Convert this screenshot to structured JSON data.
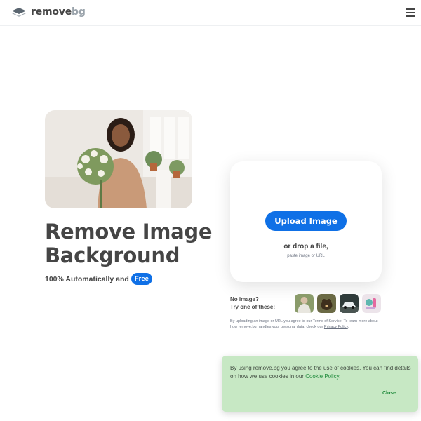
{
  "header": {
    "logo_primary": "remove",
    "logo_secondary": "bg",
    "menu_icon": "hamburger-icon"
  },
  "hero": {
    "title_line1": "Remove Image",
    "title_line2": "Background",
    "subtitle": "100% Automatically and",
    "free_badge": "Free",
    "accent_color": "#0f70e6"
  },
  "upload": {
    "button_label": "Upload Image",
    "drop_text": "or drop a file,",
    "paste_prefix": "paste image or",
    "paste_link": "URL"
  },
  "samples": {
    "line1": "No image?",
    "line2": "Try one of these:",
    "items": [
      "sample-person",
      "sample-animal",
      "sample-car",
      "sample-product"
    ]
  },
  "terms": {
    "part1": "By uploading an image or URL you agree to our",
    "tos_link": "Terms of Service",
    "part2": ". To learn more about how remove.bg handles your personal data, check our",
    "privacy_link": "Privacy Policy",
    "part3": "."
  },
  "cookie": {
    "text": "By using remove.bg you agree to the use of cookies. You can find details on how we use cookies in our",
    "link": "Cookie Policy",
    "text_end": ".",
    "close_label": "Close",
    "bg_color": "#c7e8c4"
  }
}
